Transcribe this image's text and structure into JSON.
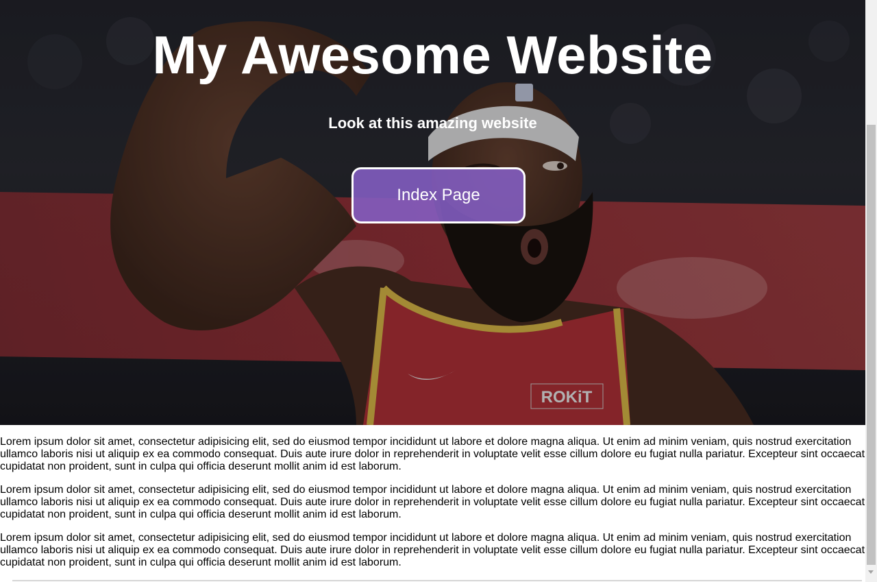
{
  "hero": {
    "title": "My Awesome Website",
    "subtitle": "Look at this amazing website",
    "button_label": "Index Page",
    "jersey_text": "ROKiT",
    "accent_color": "#845ec4"
  },
  "article": {
    "paragraphs": [
      {
        "line1": "Lorem ipsum dolor sit amet, consectetur adipisicing elit, sed do eiusmod tempor incididunt ut labore et dolore magna aliqua. Ut enim ad minim veniam, quis nostrud exercitation",
        "line2": "ullamco laboris nisi ut aliquip ex ea commodo consequat. Duis aute irure dolor in reprehenderit in voluptate velit esse cillum dolore eu fugiat nulla pariatur. Excepteur sint occaecat",
        "line3": "cupidatat non proident, sunt in culpa qui officia deserunt mollit anim id est laborum."
      },
      {
        "line1": "Lorem ipsum dolor sit amet, consectetur adipisicing elit, sed do eiusmod tempor incididunt ut labore et dolore magna aliqua. Ut enim ad minim veniam, quis nostrud exercitation",
        "line2": "ullamco laboris nisi ut aliquip ex ea commodo consequat. Duis aute irure dolor in reprehenderit in voluptate velit esse cillum dolore eu fugiat nulla pariatur. Excepteur sint occaecat",
        "line3": "cupidatat non proident, sunt in culpa qui officia deserunt mollit anim id est laborum."
      },
      {
        "line1": "Lorem ipsum dolor sit amet, consectetur adipisicing elit, sed do eiusmod tempor incididunt ut labore et dolore magna aliqua. Ut enim ad minim veniam, quis nostrud exercitation",
        "line2": "ullamco laboris nisi ut aliquip ex ea commodo consequat. Duis aute irure dolor in reprehenderit in voluptate velit esse cillum dolore eu fugiat nulla pariatur. Excepteur sint occaecat",
        "line3": "cupidatat non proident, sunt in culpa qui officia deserunt mollit anim id est laborum."
      }
    ]
  }
}
